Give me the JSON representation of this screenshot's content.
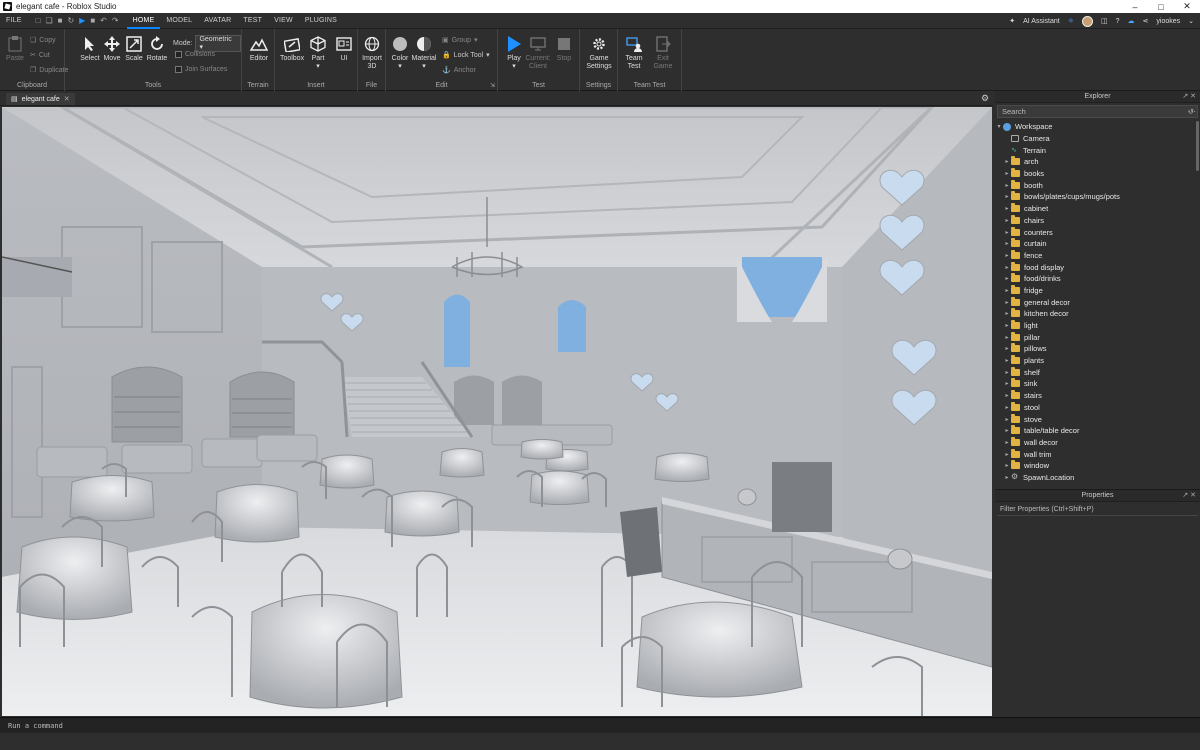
{
  "window": {
    "title": "elegant cafe - Roblox Studio"
  },
  "menu": {
    "tabs": [
      "FILE",
      "HOME",
      "MODEL",
      "AVATAR",
      "TEST",
      "VIEW",
      "PLUGINS"
    ],
    "active_tab": "HOME",
    "ai_assistant": "AI Assistant",
    "username": "yiookes"
  },
  "ribbon": {
    "clipboard": {
      "paste": "Paste",
      "copy": "Copy",
      "cut": "Cut",
      "duplicate": "Duplicate",
      "label": "Clipboard"
    },
    "tools": {
      "select": "Select",
      "move": "Move",
      "scale": "Scale",
      "rotate": "Rotate",
      "mode_label": "Mode:",
      "mode_value": "Geometric",
      "collisions": "Collisions",
      "join_surfaces": "Join Surfaces",
      "label": "Tools"
    },
    "terrain": {
      "editor": "Editor",
      "label": "Terrain"
    },
    "insert": {
      "toolbox": "Toolbox",
      "part": "Part",
      "ui": "UI",
      "label": "Insert"
    },
    "file": {
      "import3d": "Import 3D",
      "label": "File"
    },
    "edit": {
      "color": "Color",
      "material": "Material",
      "group": "Group",
      "lock_tool": "Lock Tool",
      "anchor": "Anchor",
      "label": "Edit"
    },
    "test": {
      "play": "Play",
      "current_client": "Current: Client",
      "stop": "Stop",
      "label": "Test"
    },
    "settings": {
      "game_settings": "Game Settings",
      "label": "Settings"
    },
    "team_test": {
      "team_test": "Team Test",
      "exit_game": "Exit Game",
      "label": "Team Test"
    }
  },
  "document": {
    "tab_title": "elegant cafe"
  },
  "explorer": {
    "title": "Explorer",
    "search_placeholder": "Search",
    "root": "Workspace",
    "items": [
      {
        "label": "Camera",
        "kind": "camera"
      },
      {
        "label": "Terrain",
        "kind": "terrain"
      },
      {
        "label": "arch",
        "kind": "folder"
      },
      {
        "label": "books",
        "kind": "folder"
      },
      {
        "label": "booth",
        "kind": "folder"
      },
      {
        "label": "bowls/plates/cups/mugs/pots",
        "kind": "folder"
      },
      {
        "label": "cabinet",
        "kind": "folder"
      },
      {
        "label": "chairs",
        "kind": "folder"
      },
      {
        "label": "counters",
        "kind": "folder"
      },
      {
        "label": "curtain",
        "kind": "folder"
      },
      {
        "label": "fence",
        "kind": "folder"
      },
      {
        "label": "food display",
        "kind": "folder"
      },
      {
        "label": "food/drinks",
        "kind": "folder"
      },
      {
        "label": "fridge",
        "kind": "folder"
      },
      {
        "label": "general decor",
        "kind": "folder"
      },
      {
        "label": "kitchen decor",
        "kind": "folder"
      },
      {
        "label": "light",
        "kind": "folder"
      },
      {
        "label": "pillar",
        "kind": "folder"
      },
      {
        "label": "pillows",
        "kind": "folder"
      },
      {
        "label": "plants",
        "kind": "folder"
      },
      {
        "label": "shelf",
        "kind": "folder"
      },
      {
        "label": "sink",
        "kind": "folder"
      },
      {
        "label": "stairs",
        "kind": "folder"
      },
      {
        "label": "stool",
        "kind": "folder"
      },
      {
        "label": "stove",
        "kind": "folder"
      },
      {
        "label": "table/table decor",
        "kind": "folder"
      },
      {
        "label": "wall decor",
        "kind": "folder"
      },
      {
        "label": "wall trim",
        "kind": "folder"
      },
      {
        "label": "window",
        "kind": "folder"
      },
      {
        "label": "SpawnLocation",
        "kind": "spawn"
      }
    ]
  },
  "properties": {
    "title": "Properties",
    "filter_placeholder": "Filter Properties (Ctrl+Shift+P)"
  },
  "command_bar": {
    "placeholder": "Run a command"
  },
  "colors": {
    "accent": "#0a84ff",
    "folder": "#e2b342",
    "bg": "#2e2e2e"
  }
}
